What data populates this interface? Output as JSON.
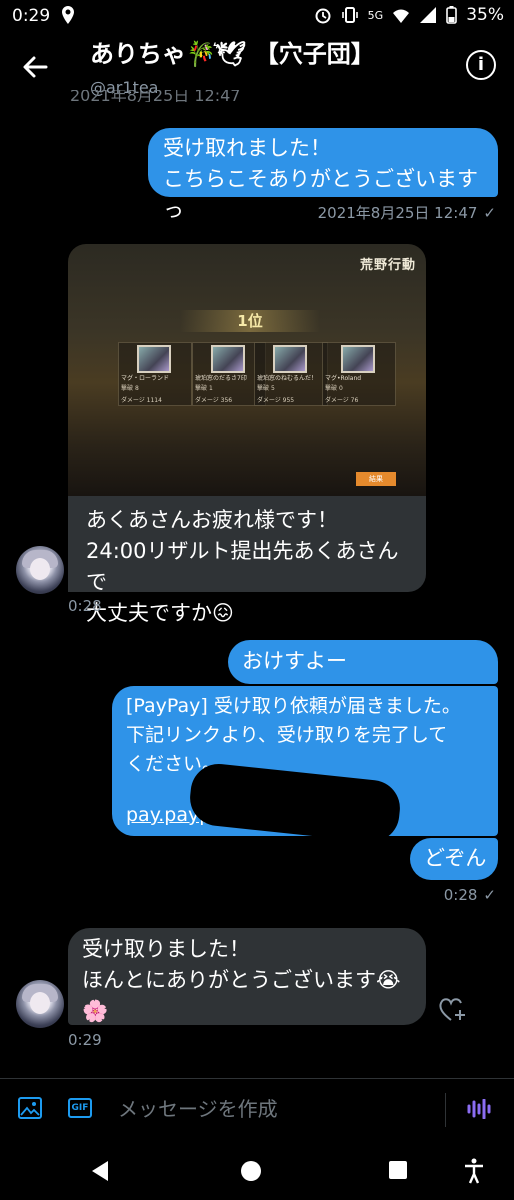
{
  "status_bar": {
    "time": "0:29",
    "battery": "35%",
    "network": "5G"
  },
  "header": {
    "title": "ありちゃ🎋͛🕊 【穴子団】",
    "handle": "@ar1tea"
  },
  "messages": {
    "sent1": {
      "lines": [
        "受け取れました！",
        "こちらこそありがとうございますっ"
      ],
      "timestamp": "2021年8月25日 12:47"
    },
    "recv1": {
      "game": {
        "logo": "荒野行動",
        "rank": "1位",
        "players": [
          {
            "name": "マグ・ローランド",
            "kills": "8",
            "damage": "1114"
          },
          {
            "name": "琥珀窓のだるさ7印",
            "kills": "1",
            "damage": "356"
          },
          {
            "name": "琥珀窓のねむるんだ！",
            "kills": "5",
            "damage": "955"
          },
          {
            "name": "マグ•Roland",
            "kills": "0",
            "damage": "76"
          }
        ],
        "stat_kills_label": "撃破",
        "stat_damage_label": "ダメージ",
        "button_label": "結果"
      },
      "lines": [
        "あくあさんお疲れ様です！",
        "24:00リザルト提出先あくあさんで",
        "大丈夫ですか😖"
      ],
      "timestamp": "0:28"
    },
    "sent2": {
      "text": "おけすよー"
    },
    "sent3": {
      "lines": [
        "[PayPay] 受け取り依頼が届きました。",
        "下記リンクより、受け取りを完了して",
        "ください。"
      ],
      "link": "pay.paypay..."
    },
    "sent4": {
      "text": "どぞん",
      "timestamp": "0:28"
    },
    "recv2": {
      "lines": [
        "受け取りました！",
        "ほんとにありがとうございます😭",
        "🌸"
      ],
      "timestamp": "0:29"
    }
  },
  "composer": {
    "placeholder": "メッセージを作成",
    "gif_label": "GIF"
  }
}
